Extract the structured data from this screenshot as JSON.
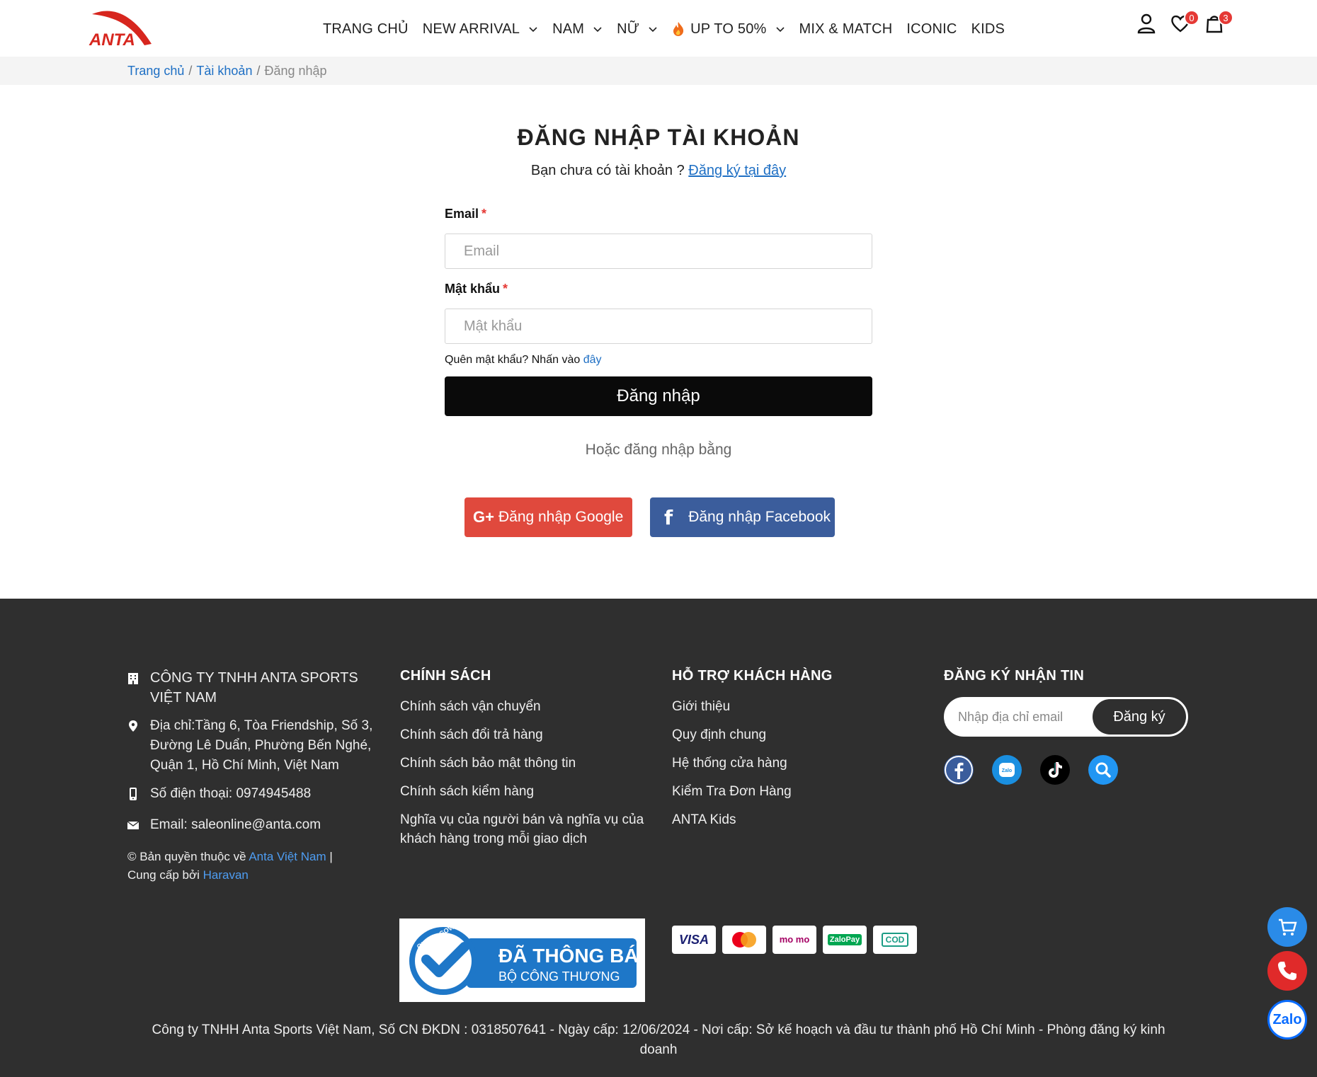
{
  "header": {
    "logo_text": "ANTA",
    "nav": [
      {
        "label": "TRANG CHỦ",
        "dropdown": false
      },
      {
        "label": "NEW ARRIVAL",
        "dropdown": true
      },
      {
        "label": "NAM",
        "dropdown": true
      },
      {
        "label": "NỮ",
        "dropdown": true
      },
      {
        "label": "UP TO 50%",
        "dropdown": true
      },
      {
        "label": "MIX & MATCH",
        "dropdown": false
      },
      {
        "label": "ICONIC",
        "dropdown": false
      },
      {
        "label": "KIDS",
        "dropdown": false
      }
    ],
    "wishlist_count": "0",
    "cart_count": "3"
  },
  "breadcrumb": {
    "home": "Trang chủ",
    "account": "Tài khoản",
    "current": "Đăng nhập",
    "sep": "/"
  },
  "login": {
    "title": "ĐĂNG NHẬP TÀI KHOẢN",
    "subtitle": "Bạn chưa có tài khoản ?",
    "register_link": "Đăng ký tại đây",
    "email_label": "Email",
    "email_placeholder": "Email",
    "password_label": "Mật khẩu",
    "password_placeholder": "Mật khẩu",
    "required_mark": "*",
    "forgot_text": "Quên mật khẩu? Nhấn vào",
    "forgot_link": "đây",
    "submit": "Đăng nhập",
    "or_text": "Hoặc đăng nhập bằng",
    "google": "Đăng nhập Google",
    "facebook": "Đăng nhập Facebook",
    "google_glyph": "G+",
    "facebook_glyph": "f"
  },
  "footer": {
    "company": "CÔNG TY TNHH ANTA SPORTS VIỆT NAM",
    "address": "Địa chỉ:Tầng 6, Tòa Friendship, Số 3, Đường Lê Duẩn, Phường Bến Nghé, Quận 1, Hồ Chí Minh, Việt Nam",
    "phone": "Số điện thoại: 0974945488",
    "email": "Email: saleonline@anta.com",
    "copyright_prefix": "© Bản quyền thuộc về",
    "copyright_link": "Anta Việt Nam",
    "copyright_sep": "|",
    "provided_prefix": "Cung cấp bởi",
    "provided_link": "Haravan",
    "policy_title": "CHÍNH SÁCH",
    "policies": [
      "Chính sách vận chuyển",
      "Chính sách đổi trả hàng",
      "Chính sách bảo mật thông tin",
      "Chính sách kiểm hàng",
      "Nghĩa vụ của người bán và nghĩa vụ của khách hàng trong mỗi giao dịch"
    ],
    "support_title": "HỖ TRỢ KHÁCH HÀNG",
    "support": [
      "Giới thiệu",
      "Quy định chung",
      "Hệ thống cửa hàng",
      "Kiểm Tra Đơn Hàng",
      "ANTA Kids"
    ],
    "newsletter_title": "ĐĂNG KÝ NHẬN TIN",
    "newsletter_placeholder": "Nhập địa chỉ email",
    "newsletter_button": "Đăng ký",
    "cert_line1": "ĐÃ THÔNG BÁO",
    "cert_line2": "BỘ CÔNG THƯƠNG",
    "cert_seal": "ONLINE.GOV.VN",
    "payments": [
      "VISA",
      "mastercard",
      "momo",
      "ZaloPay",
      "COD"
    ],
    "payment_labels": {
      "visa": "VISA",
      "momo": "mo mo",
      "zalopay": "ZaloPay",
      "cod": "COD"
    },
    "legal": "Công ty TNHH Anta Sports Việt Nam, Số CN ĐKDN : 0318507641 - Ngày cấp: 12/06/2024 - Nơi cấp: Sở kế hoạch và đầu tư thành phố Hồ Chí Minh - Phòng đăng ký kinh doanh"
  },
  "floating": {
    "zalo": "Zalo"
  },
  "colors": {
    "brand_red": "#e0493d",
    "facebook_blue": "#3b5d9c",
    "link_blue": "#1e6fc4",
    "footer_bg": "#2f2f2f"
  },
  "icons": {
    "user": "user-icon",
    "heart": "heart-icon",
    "cart": "shopping-bag-icon",
    "fire": "fire-icon"
  }
}
